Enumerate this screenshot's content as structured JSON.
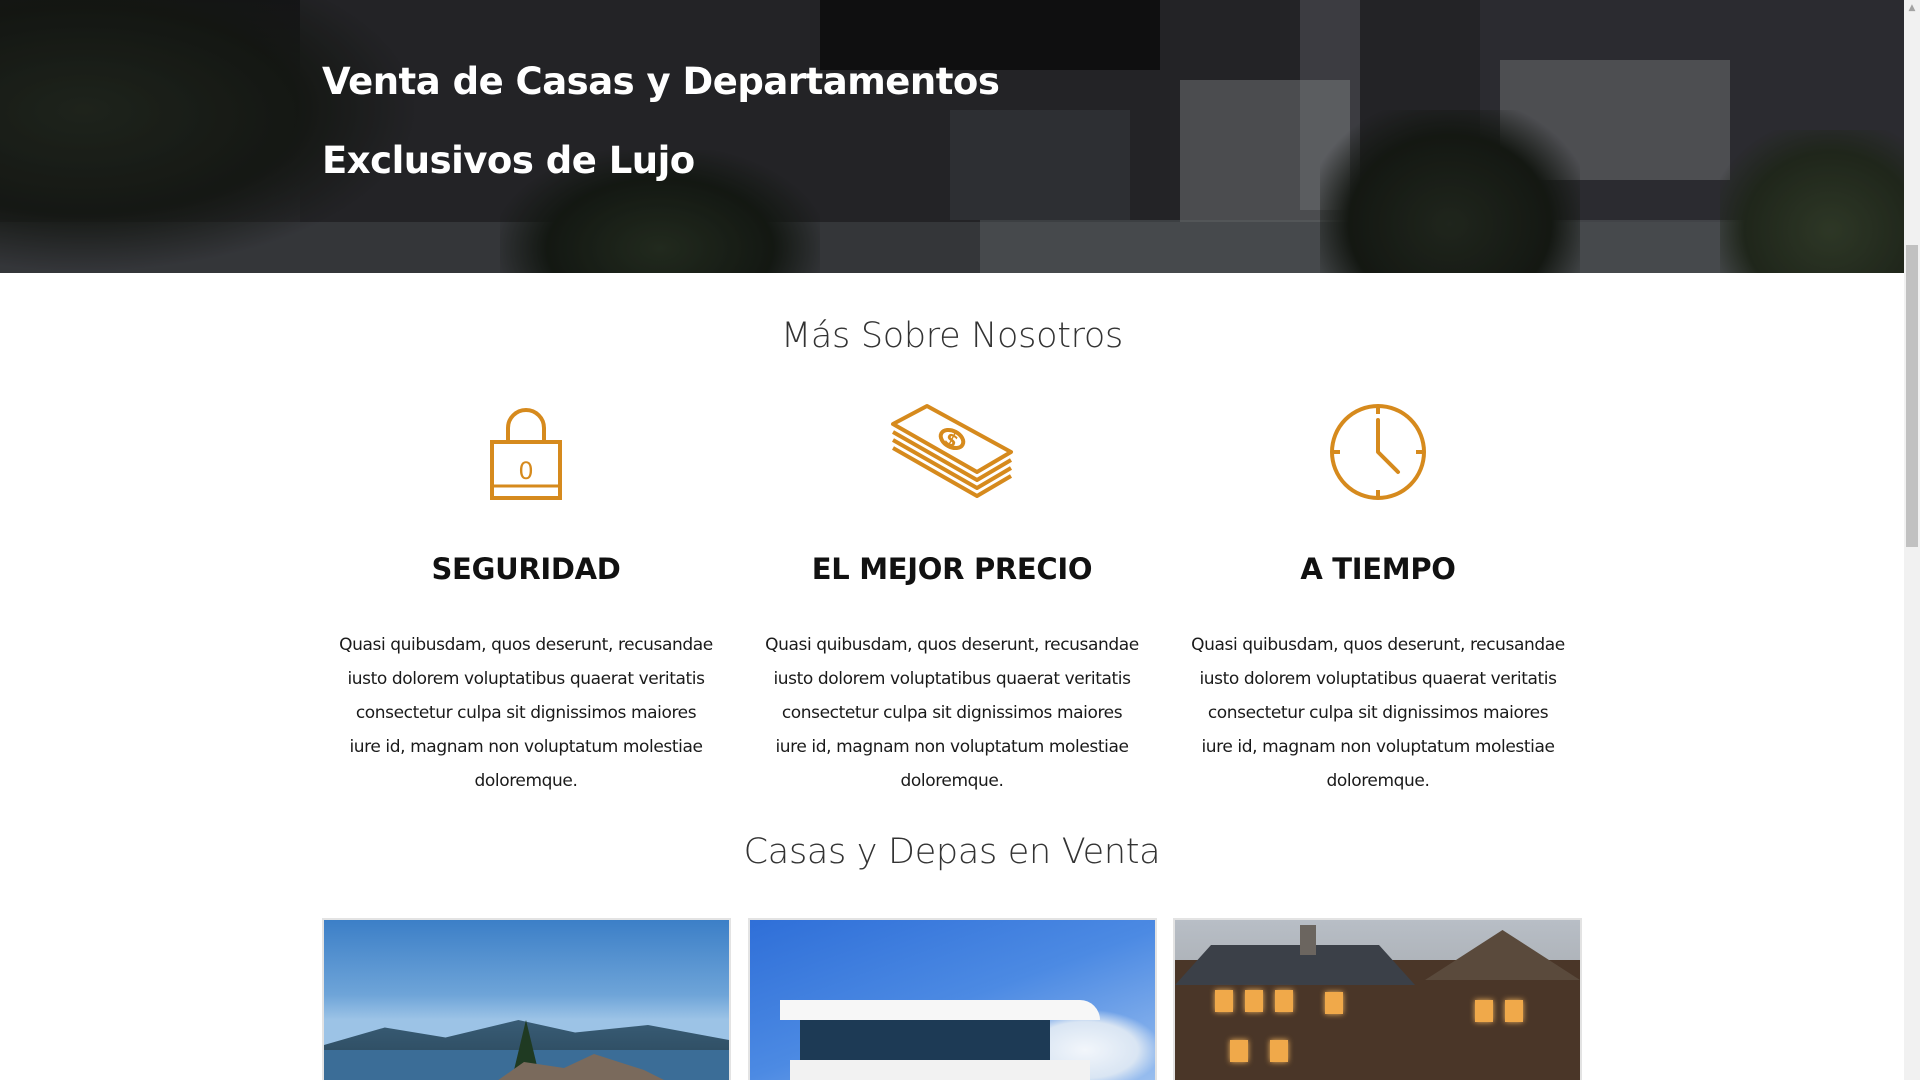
{
  "hero": {
    "title_line1": "Venta de Casas y Departamentos",
    "title_line2": "Exclusivos de Lujo"
  },
  "about": {
    "title": "Más Sobre Nosotros",
    "features": [
      {
        "icon": "padlock-icon",
        "lock_digit": "0",
        "title": "SEGURIDAD",
        "text": "Quasi quibusdam, quos deserunt, recusandae iusto dolorem voluptatibus quaerat veritatis consectetur culpa sit dignissimos maiores iure id, magnam non voluptatum molestiae doloremque."
      },
      {
        "icon": "money-stack-icon",
        "title": "EL MEJOR PRECIO",
        "text": "Quasi quibusdam, quos deserunt, recusandae iusto dolorem voluptatibus quaerat veritatis consectetur culpa sit dignissimos maiores iure id, magnam non voluptatum molestiae doloremque."
      },
      {
        "icon": "clock-icon",
        "title": "A TIEMPO",
        "text": "Quasi quibusdam, quos deserunt, recusandae iusto dolorem voluptatibus quaerat veritatis consectetur culpa sit dignissimos maiores iure id, magnam non voluptatum molestiae doloremque."
      }
    ]
  },
  "listings": {
    "title": "Casas y Depas en Venta",
    "items": [
      {
        "photo": "lake-house-photo"
      },
      {
        "photo": "modern-house-photo"
      },
      {
        "photo": "wood-lodge-photo"
      }
    ]
  },
  "colors": {
    "accent": "#d68a1d",
    "heading": "#111111",
    "section_title": "#333333"
  }
}
